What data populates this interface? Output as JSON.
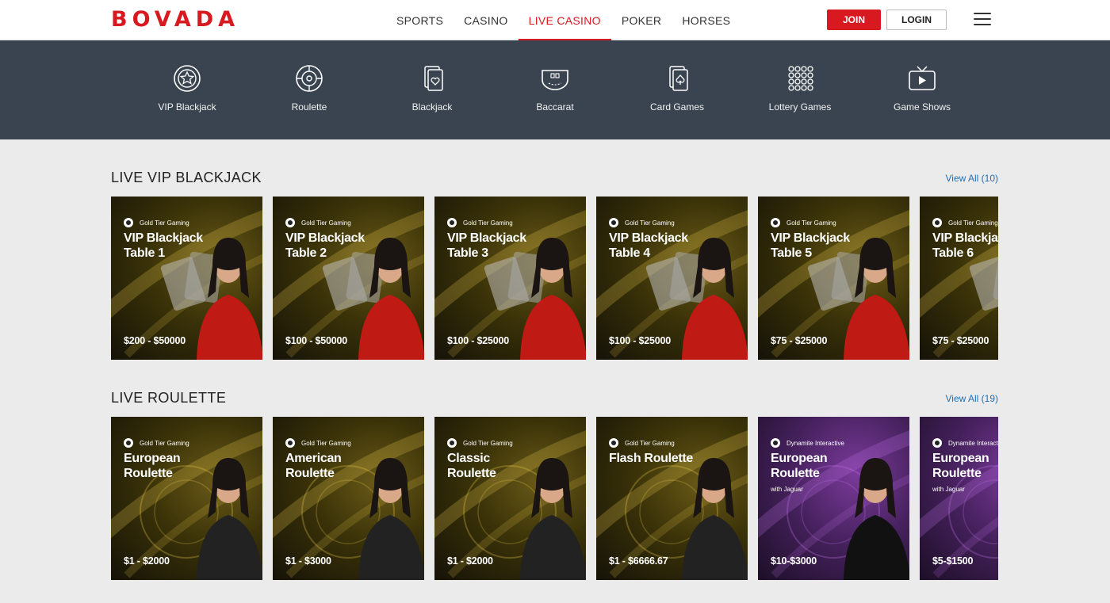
{
  "header": {
    "logo": "BOVADA",
    "nav": [
      "SPORTS",
      "CASINO",
      "LIVE CASINO",
      "POKER",
      "HORSES"
    ],
    "join_label": "JOIN",
    "login_label": "LOGIN"
  },
  "categories": [
    {
      "label": "VIP Blackjack",
      "icon": "vip-chip-icon"
    },
    {
      "label": "Roulette",
      "icon": "roulette-wheel-icon"
    },
    {
      "label": "Blackjack",
      "icon": "cards-heart-icon"
    },
    {
      "label": "Baccarat",
      "icon": "baccarat-table-icon"
    },
    {
      "label": "Card Games",
      "icon": "cards-spade-icon"
    },
    {
      "label": "Lottery Games",
      "icon": "lottery-grid-icon"
    },
    {
      "label": "Game Shows",
      "icon": "tv-play-icon"
    }
  ],
  "blackjack": {
    "title": "LIVE VIP BLACKJACK",
    "view_all": "View All (10)",
    "cards": [
      {
        "provider": "Gold Tier Gaming",
        "line1": "VIP Blackjack",
        "line2": "Table 1",
        "limits": "$200 - $50000"
      },
      {
        "provider": "Gold Tier Gaming",
        "line1": "VIP Blackjack",
        "line2": "Table 2",
        "limits": "$100 - $50000"
      },
      {
        "provider": "Gold Tier Gaming",
        "line1": "VIP Blackjack",
        "line2": "Table 3",
        "limits": "$100 - $25000"
      },
      {
        "provider": "Gold Tier Gaming",
        "line1": "VIP Blackjack",
        "line2": "Table 4",
        "limits": "$100 - $25000"
      },
      {
        "provider": "Gold Tier Gaming",
        "line1": "VIP Blackjack",
        "line2": "Table 5",
        "limits": "$75 - $25000"
      },
      {
        "provider": "Gold Tier Gaming",
        "line1": "VIP Blackjack",
        "line2": "Table 6",
        "limits": "$75 - $25000"
      }
    ]
  },
  "roulette": {
    "title": "LIVE ROULETTE",
    "view_all": "View All (19)",
    "cards": [
      {
        "provider": "Gold Tier Gaming",
        "line1": "European",
        "line2": "Roulette",
        "sub": "",
        "limits": "$1 - $2000",
        "theme": "gold"
      },
      {
        "provider": "Gold Tier Gaming",
        "line1": "American",
        "line2": "Roulette",
        "sub": "",
        "limits": "$1 - $3000",
        "theme": "gold"
      },
      {
        "provider": "Gold Tier Gaming",
        "line1": "Classic",
        "line2": "Roulette",
        "sub": "",
        "limits": "$1 - $2000",
        "theme": "gold"
      },
      {
        "provider": "Gold Tier Gaming",
        "line1": "Flash Roulette",
        "line2": "",
        "sub": "",
        "limits": "$1 - $6666.67",
        "theme": "gold"
      },
      {
        "provider": "Dynamite Interactive",
        "line1": "European",
        "line2": "Roulette",
        "sub": "with Jaguar",
        "limits": "$10-$3000",
        "theme": "purple"
      },
      {
        "provider": "Dynamite Interactive",
        "line1": "European",
        "line2": "Roulette",
        "sub": "with Jaguar",
        "limits": "$5-$1500",
        "theme": "purple"
      }
    ]
  },
  "colors": {
    "brand": "#d8191f",
    "catbar": "#3a4450",
    "link": "#1e6fb4"
  }
}
